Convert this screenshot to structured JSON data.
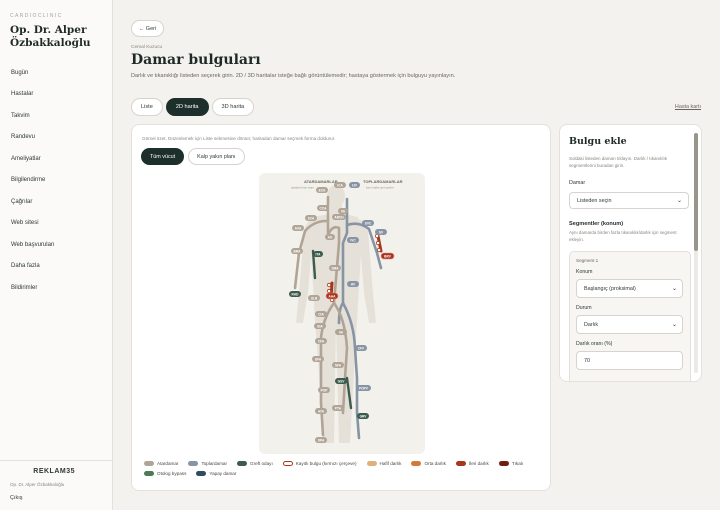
{
  "sidebar": {
    "brand": "CARDIOCLINIC",
    "doctor": "Op. Dr. Alper Özbakkaloğlu",
    "items": [
      {
        "label": "Bugün"
      },
      {
        "label": "Hastalar"
      },
      {
        "label": "Takvim"
      },
      {
        "label": "Randevu"
      },
      {
        "label": "Ameliyatlar"
      },
      {
        "label": "Bilgilendirme"
      },
      {
        "label": "Çağrılar"
      },
      {
        "label": "Web sitesi"
      },
      {
        "label": "Web başvuruları"
      },
      {
        "label": "Daha fazla"
      },
      {
        "label": "Bildirimler"
      }
    ],
    "footer_logo": "REKLAM35",
    "footer_doctor": "Op. Dr. Alper Özbakkaloğlu",
    "logout": "Çıkış"
  },
  "header": {
    "back": "← Geri",
    "kicker": "Cemal Kuzucu",
    "title": "Damar bulguları",
    "description": "Darlık ve tıkanıklığı listeden seçerek girin. 2D / 3D haritalar isteğe bağlı görüntülemedir; hastaya göstermek için bulguyu yayınlayın.",
    "tabs": [
      {
        "label": "Liste"
      },
      {
        "label": "2D harita"
      },
      {
        "label": "3D harita"
      }
    ],
    "active_tab": "2D harita",
    "patient_link": "Hasta kartı"
  },
  "map": {
    "hint": "Görsel özet. Düzenlemek için Liste sekmesine dönün; haritadan damar seçmek forma doldurur.",
    "tabs": [
      {
        "label": "Tüm vücut"
      },
      {
        "label": "Kalp yakın planı"
      }
    ],
    "active_tab": "Tüm vücut",
    "heading_left": "ATARDAMARLAR",
    "sub_left": "oksijenli kan taşır",
    "heading_right": "TOPLARDAMARLAR",
    "sub_right": "kanı kalbe geri getirir",
    "labels": {
      "ecaL": "ECA",
      "icaL": "ICA",
      "ijvL": "IJV",
      "cca": "CCA",
      "vert": "VA",
      "sca": "SCA",
      "arch": "ARCH",
      "svc": "SVC",
      "ao": "AO",
      "axa": "AXA",
      "bra": "BRA",
      "ivc": "IVC",
      "sv": "SV",
      "ita": "ITA",
      "sma": "SMA",
      "brv": "BRV",
      "rad": "RAD",
      "hv": "HV",
      "aaa": "AAA",
      "ulb": "ULB",
      "cia": "CIA",
      "eia": "EIA",
      "ica": "IIA",
      "cfa": "CFA",
      "ccv": "CFV",
      "dfa": "DFA",
      "sfa": "SFA",
      "gsv": "GSV",
      "pop": "POP",
      "popv": "POPV",
      "ata": "ATA",
      "pta": "PTA",
      "dpa": "DPA",
      "grv": "GRV"
    }
  },
  "legend": [
    {
      "label": "Atardamar",
      "color": "#b0a497"
    },
    {
      "label": "Toplardamar",
      "color": "#8794a3"
    },
    {
      "label": "Greft odayı",
      "color": "#3b5b4e"
    },
    {
      "label": "Kayıtlı bulgu (kırmızı çerçeve)",
      "color": "#ffffff"
    },
    {
      "label": "Hafif darlık",
      "color": "#e0b07a"
    },
    {
      "label": "Orta darlık",
      "color": "#d07a3e"
    },
    {
      "label": "İleri darlık",
      "color": "#a8361c"
    },
    {
      "label": "Tıkalı",
      "color": "#6e1e12"
    },
    {
      "label": "Otolog bypass",
      "color": "#4e7a55"
    },
    {
      "label": "Yapay damar",
      "color": "#2d4c5e"
    }
  ],
  "form": {
    "title": "Bulgu ekle",
    "help": "Soldaki listeden damarı tıklayın. Darlık / tıkanıklık segmentlerini buradan girin.",
    "vessel_label": "Damar",
    "vessel_value": "Listeden seçin",
    "segments_label": "Segmentler (konum)",
    "segments_help": "Aynı damarda birden fazla tıkanıklık/darlık için segment ekleyin.",
    "segment_title": "Segment 1",
    "location_label": "Konum",
    "location_value": "Başlangıç (proksimal)",
    "status_label": "Durum",
    "status_value": "Darlık",
    "degree_label": "Darlık oranı (%)",
    "degree_value": "70"
  }
}
